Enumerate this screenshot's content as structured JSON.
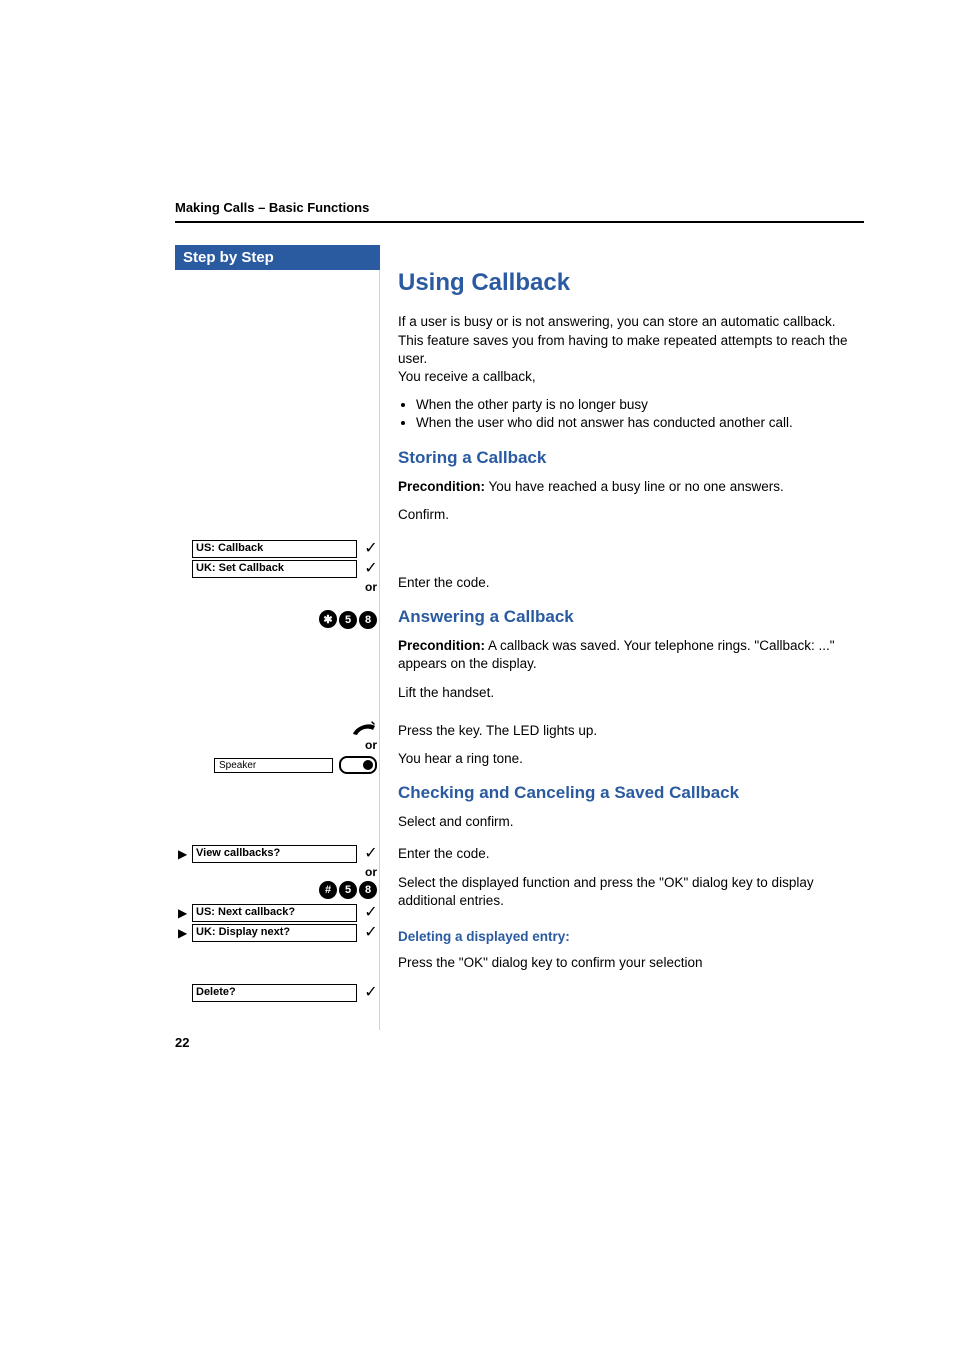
{
  "running_head": "Making Calls – Basic Functions",
  "sidebar_title": "Step by Step",
  "page_number": "22",
  "s1": {
    "title": "Using Callback",
    "intro_p": "If a user is busy or is not answering, you can store an automatic callback. This feature saves you from having to make repeated attempts to reach the user.\nYou receive a callback,",
    "bullets": [
      "When the other party is no longer busy",
      "When the user who did not answer has conducted another call."
    ]
  },
  "storing": {
    "title": "Storing a Callback",
    "precond_label": "Precondition:",
    "precond_text": " You have reached a busy line or no one answers.",
    "confirm": "Confirm.",
    "display_us": "US: Callback",
    "display_uk": "UK: Set Callback",
    "or": "or",
    "code_keys": [
      "q",
      "5",
      "8"
    ],
    "enter_code": "Enter the code."
  },
  "answering": {
    "title": "Answering a Callback",
    "precond_label": "Precondition:",
    "precond_text": " A callback was saved. Your telephone rings. \"Callback: ...\" appears on the display.",
    "lift": "Lift the handset.",
    "or": "or",
    "speaker_label": "Speaker",
    "press_key": "Press the key. The LED lights up.",
    "ringtone": "You hear a ring tone."
  },
  "checking": {
    "title": "Checking and Canceling a Saved Callback",
    "view_label": "View callbacks?",
    "select_confirm": "Select and confirm.",
    "or": "or",
    "code_keys": [
      "r",
      "5",
      "8"
    ],
    "enter_code": "Enter the code.",
    "next_us": "US: Next callback?",
    "next_uk": "UK: Display next?",
    "next_text": "Select the displayed function and press the \"OK\" dialog key to display additional entries.",
    "delete_head": "Deleting a displayed entry:",
    "delete_label": "Delete?",
    "delete_text": "Press the \"OK\" dialog key to confirm your selection"
  }
}
